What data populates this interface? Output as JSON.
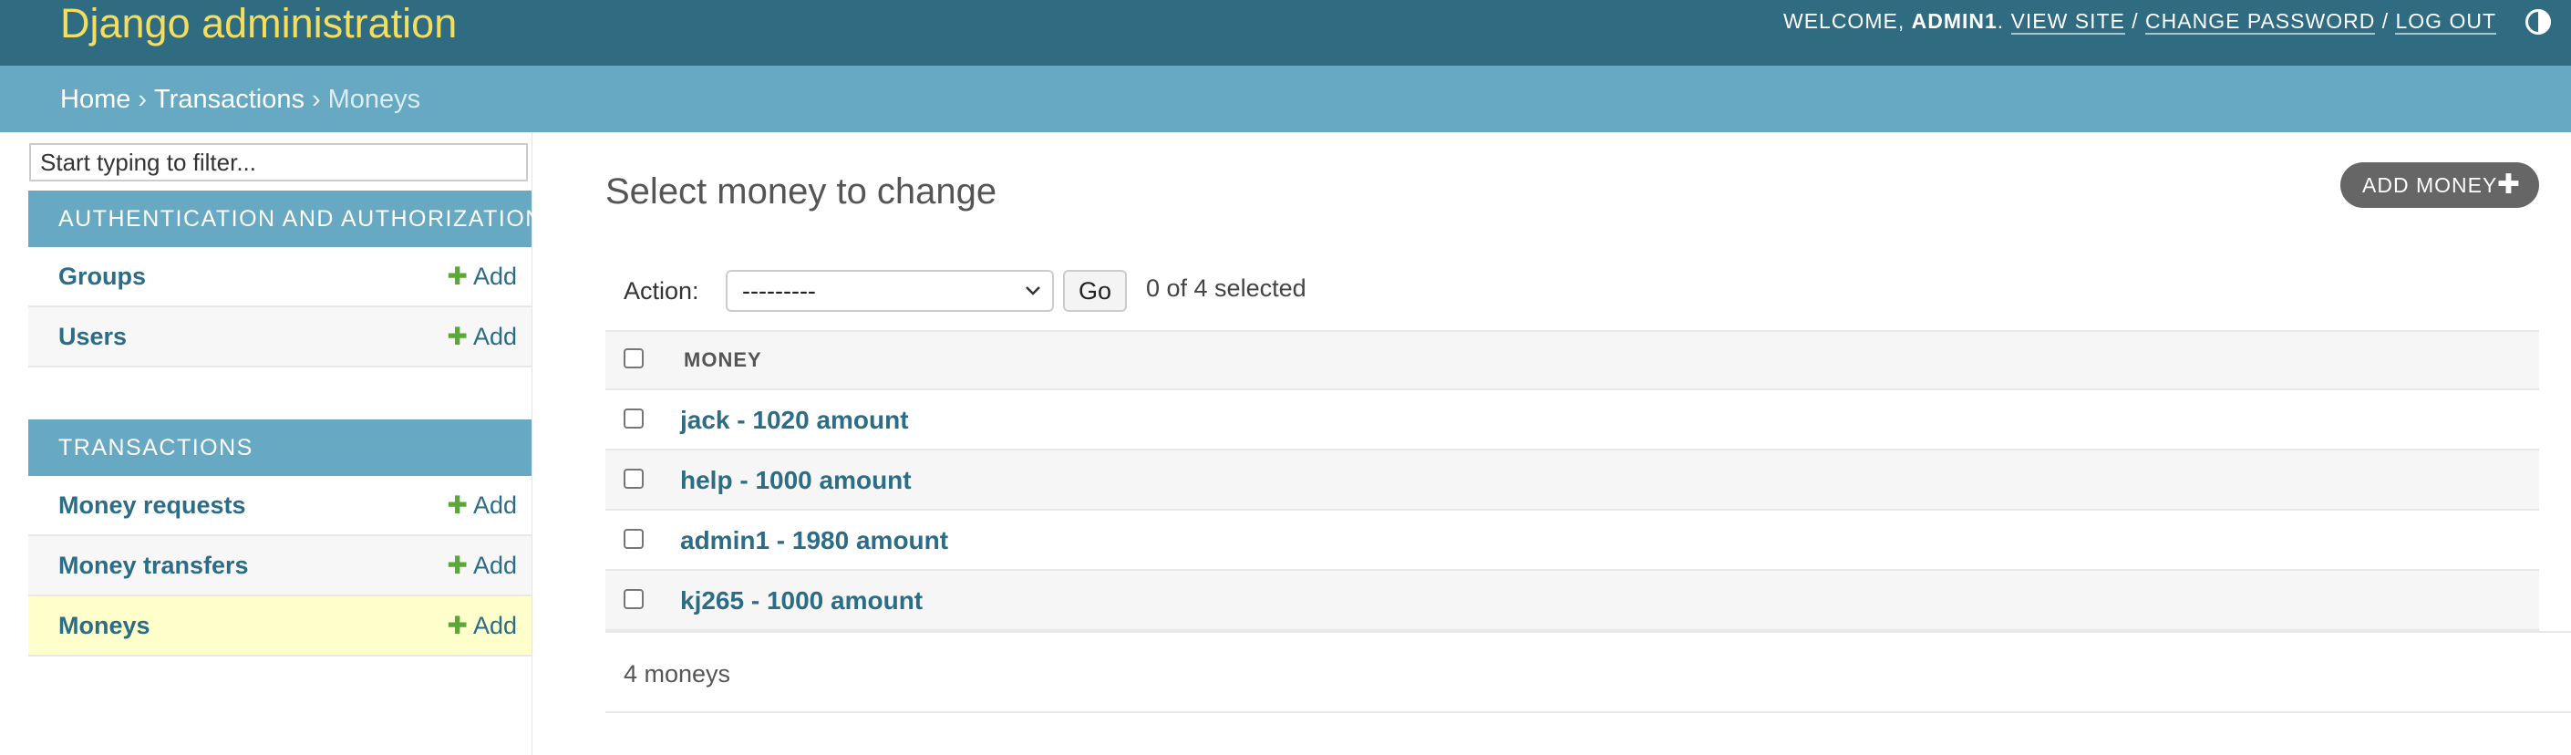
{
  "header": {
    "branding": "Django administration",
    "welcome": "WELCOME, ",
    "username": "ADMIN1",
    "period": ". ",
    "view_site": "VIEW SITE",
    "sep": " / ",
    "change_password": "CHANGE PASSWORD",
    "log_out": "LOG OUT",
    "theme_icon": "theme-toggle-icon"
  },
  "breadcrumbs": {
    "home": "Home",
    "separator": "›",
    "app": "Transactions",
    "current": "Moneys"
  },
  "sidebar": {
    "filter_placeholder": "Start typing to filter...",
    "modules": [
      {
        "caption": "AUTHENTICATION AND AUTHORIZATION",
        "models": [
          {
            "name": "Groups",
            "add": "Add"
          },
          {
            "name": "Users",
            "add": "Add"
          }
        ]
      },
      {
        "caption": "TRANSACTIONS",
        "models": [
          {
            "name": "Money requests",
            "add": "Add"
          },
          {
            "name": "Money transfers",
            "add": "Add"
          },
          {
            "name": "Moneys",
            "add": "Add",
            "current": true
          }
        ]
      }
    ]
  },
  "main": {
    "title": "Select money to change",
    "add_button": "ADD MONEY",
    "action_label": "Action:",
    "action_selected": "---------",
    "go_label": "Go",
    "selected_count": "0 of 4 selected",
    "column_header": "MONEY",
    "rows": [
      "jack - 1020 amount",
      "help - 1000 amount",
      "admin1 - 1980 amount",
      "kj265 - 1000 amount"
    ],
    "paginator": "4 moneys"
  },
  "colors": {
    "header_bg": "#2f6c82",
    "branding": "#f5dd5d",
    "breadcrumbs_bg": "#67a8c2",
    "link": "#2b6c86",
    "add_plus": "#5aa937",
    "current_row": "#ffffcc"
  }
}
